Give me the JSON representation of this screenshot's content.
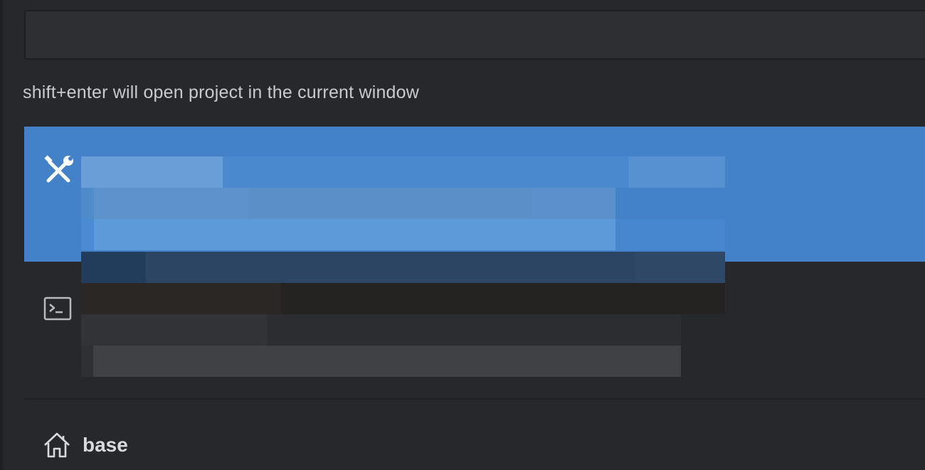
{
  "search": {
    "value": "",
    "placeholder": ""
  },
  "hint": "shift+enter will open project in the current window",
  "projects": [
    {
      "icon": "tools-icon",
      "selected": true
    },
    {
      "icon": "terminal-icon",
      "selected": false
    }
  ],
  "footer": {
    "label": "base",
    "icon": "home-icon"
  },
  "colors": {
    "selected": "#4382c8",
    "background": "#27282b"
  }
}
